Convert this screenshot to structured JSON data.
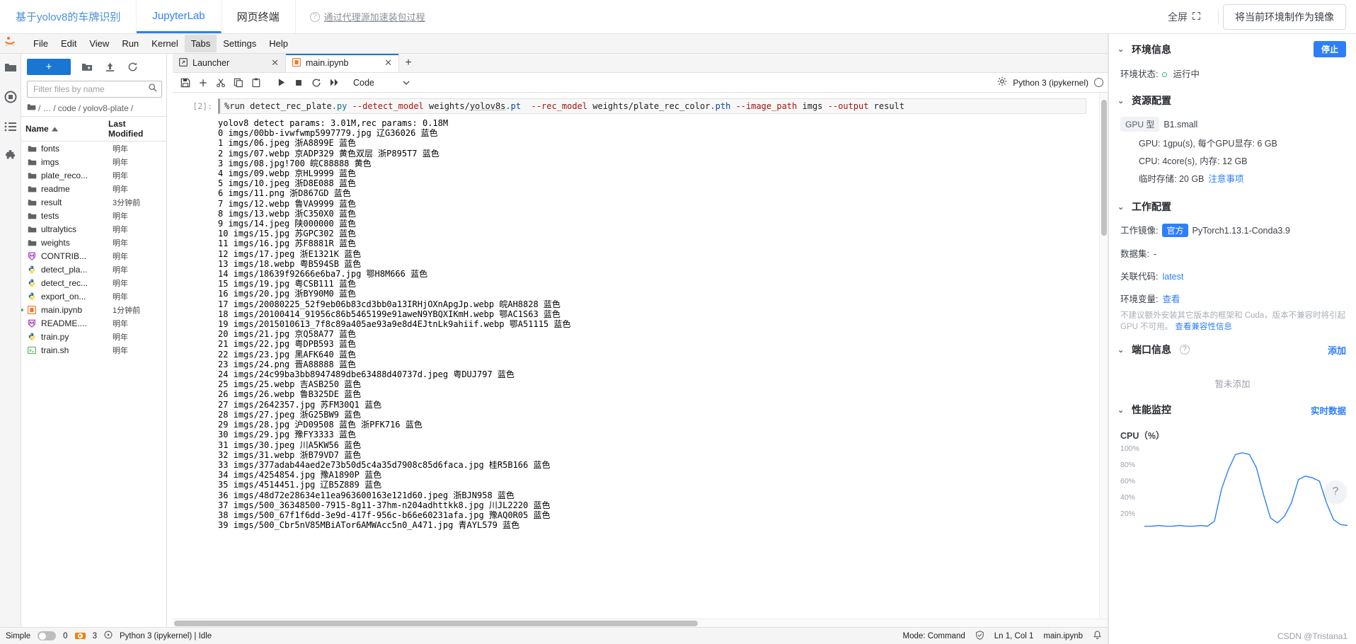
{
  "platform": {
    "tabs": [
      {
        "label": "基于yolov8的车牌识别",
        "active": false,
        "style": "link"
      },
      {
        "label": "JupyterLab",
        "active": true,
        "style": "link"
      },
      {
        "label": "网页终端",
        "active": false,
        "style": "dark"
      }
    ],
    "note": "通过代理源加速装包过程",
    "fullscreen_label": "全屏",
    "mirror_button": "将当前环境制作为镜像"
  },
  "jupyter": {
    "menus": [
      "File",
      "Edit",
      "View",
      "Run",
      "Kernel",
      "Tabs",
      "Settings",
      "Help"
    ],
    "selected_menu": "Tabs",
    "filebrowser": {
      "new_button": "+",
      "filter_placeholder": "Filter files by name",
      "filter_value": "",
      "breadcrumb": [
        "/",
        "…",
        "code",
        "yolov8-plate",
        "/"
      ],
      "columns": {
        "name": "Name",
        "modified": "Last Modified"
      },
      "rows": [
        {
          "icon": "folder-icon",
          "name": "fonts",
          "modified": "明年",
          "running": false
        },
        {
          "icon": "folder-icon",
          "name": "imgs",
          "modified": "明年",
          "running": false
        },
        {
          "icon": "folder-icon",
          "name": "plate_reco...",
          "modified": "明年",
          "running": false
        },
        {
          "icon": "folder-icon",
          "name": "readme",
          "modified": "明年",
          "running": false
        },
        {
          "icon": "folder-icon",
          "name": "result",
          "modified": "3分钟前",
          "running": false
        },
        {
          "icon": "folder-icon",
          "name": "tests",
          "modified": "明年",
          "running": false
        },
        {
          "icon": "folder-icon",
          "name": "ultralytics",
          "modified": "明年",
          "running": false
        },
        {
          "icon": "folder-icon",
          "name": "weights",
          "modified": "明年",
          "running": false
        },
        {
          "icon": "markdown-icon",
          "name": "CONTRIB...",
          "modified": "明年",
          "running": false
        },
        {
          "icon": "python-icon",
          "name": "detect_pla...",
          "modified": "明年",
          "running": false
        },
        {
          "icon": "python-icon",
          "name": "detect_rec...",
          "modified": "明年",
          "running": false
        },
        {
          "icon": "python-icon",
          "name": "export_on...",
          "modified": "明年",
          "running": false
        },
        {
          "icon": "notebook-icon",
          "name": "main.ipynb",
          "modified": "1分钟前",
          "running": true
        },
        {
          "icon": "markdown-icon",
          "name": "README....",
          "modified": "明年",
          "running": false
        },
        {
          "icon": "python-icon",
          "name": "train.py",
          "modified": "明年",
          "running": false
        },
        {
          "icon": "shell-icon",
          "name": "train.sh",
          "modified": "明年",
          "running": false
        }
      ]
    },
    "dock_tabs": [
      {
        "label": "Launcher",
        "icon": "launcher-icon",
        "active": false
      },
      {
        "label": "main.ipynb",
        "icon": "notebook-icon",
        "active": true
      }
    ],
    "dock_add": "+",
    "notebook_toolbar": {
      "cell_type": "Code",
      "kernel_name": "Python 3 (ipykernel)"
    },
    "cell": {
      "prompt": "[2]:",
      "code_parts": [
        {
          "t": "%run detect_rec_plate",
          "c": "plain"
        },
        {
          "t": ".py",
          "c": "str"
        },
        {
          "t": " ",
          "c": "plain"
        },
        {
          "t": "--detect_model",
          "c": "op"
        },
        {
          "t": " weights/",
          "c": "plain"
        },
        {
          "t": "yolov8s",
          "c": "sq"
        },
        {
          "t": ".pt",
          "c": "blue"
        },
        {
          "t": "  ",
          "c": "plain"
        },
        {
          "t": "--rec_model",
          "c": "op"
        },
        {
          "t": " weights/plate_rec_color",
          "c": "plain"
        },
        {
          "t": ".pth",
          "c": "blue"
        },
        {
          "t": " ",
          "c": "plain"
        },
        {
          "t": "--image_path",
          "c": "op"
        },
        {
          "t": " imgs ",
          "c": "plain"
        },
        {
          "t": "--output",
          "c": "op"
        },
        {
          "t": " result",
          "c": "plain"
        }
      ],
      "code_plain": "%run detect_rec_plate.py --detect_model weights/yolov8s.pt  --rec_model weights/plate_rec_color.pth --image_path imgs --output result",
      "output_lines": [
        "yolov8 detect params: 3.01M,rec params: 0.18M",
        "0 imgs/00bb-ivwfwmp5997779.jpg 辽G36026 蓝色",
        "1 imgs/06.jpeg 浙A8899E 蓝色",
        "2 imgs/07.webp 京ADP329 黄色双层 浙P895T7 蓝色",
        "3 imgs/08.jpg!700 皖C88888 黄色",
        "4 imgs/09.webp 京HL9999 蓝色",
        "5 imgs/10.jpeg 浙D8E088 蓝色",
        "6 imgs/11.png 浙D867GD 蓝色",
        "7 imgs/12.webp 鲁VA9999 蓝色",
        "8 imgs/13.webp 浙C350X0 蓝色",
        "9 imgs/14.jpeg 陕000000 蓝色",
        "10 imgs/15.jpg 苏GPC302 蓝色",
        "11 imgs/16.jpg 苏F8881R 蓝色",
        "12 imgs/17.jpeg 浙E1321K 蓝色",
        "13 imgs/18.webp 粤B594SB 蓝色",
        "14 imgs/18639f92666e6ba7.jpg 鄂H8M666 蓝色",
        "15 imgs/19.jpg 粤CSB111 蓝色",
        "16 imgs/20.jpg 浙BY90M0 蓝色",
        "17 imgs/20080225_52f9eb06b83cd3bb0a13IRHjOXnApgJp.webp 皖AH8828 蓝色",
        "18 imgs/20100414_91956c86b5465199e91aweN9YBQXIKmH.webp 鄂AC1S63 蓝色",
        "19 imgs/2015010613_7f8c89a405ae93a9e8d4EJtnLk9ahiif.webp 鄂A51115 蓝色",
        "20 imgs/21.jpg 京Q58A77 蓝色",
        "21 imgs/22.jpg 粤DPB593 蓝色",
        "22 imgs/23.jpg 黑AFK640 蓝色",
        "23 imgs/24.png 晋A88888 蓝色",
        "24 imgs/24c99ba3bb8947489dbe63488d40737d.jpeg 粤DUJ797 蓝色",
        "25 imgs/25.webp 吉ASB250 蓝色",
        "26 imgs/26.webp 鲁B325DE 蓝色",
        "27 imgs/2642357.jpg 苏FM30Q1 蓝色",
        "28 imgs/27.jpeg 浙G25BW9 蓝色",
        "29 imgs/28.jpg 沪D09508 蓝色 浙PFK716 蓝色",
        "30 imgs/29.jpg 豫FY3333 蓝色",
        "31 imgs/30.jpeg 川A5KW56 蓝色",
        "32 imgs/31.webp 浙B79VD7 蓝色",
        "33 imgs/377adab44aed2e73b50d5c4a35d7908c85d6faca.jpg 桂R5B166 蓝色",
        "34 imgs/4254854.jpg 豫A1890P 蓝色",
        "35 imgs/4514451.jpg 辽B5Z889 蓝色",
        "36 imgs/48d72e28634e11ea963600163e121d60.jpeg 浙BJN958 蓝色",
        "37 imgs/500_36348500-7915-8g11-37hm-n204adhttkk8.jpg 川JL2220 蓝色",
        "38 imgs/500_67f1f6dd-3e9d-417f-956c-b66e60231afa.jpg 豫AQ0R05 蓝色",
        "39 imgs/500_Cbr5nV85MBiATor6AMWAcc5n0_A471.jpg 青AYL579 蓝色"
      ]
    },
    "statusbar": {
      "mode_label": "Simple",
      "terminals": "0",
      "kernels": "3",
      "kernel_status": "Python 3 (ipykernel) | Idle",
      "mode": "Mode: Command",
      "position": "Ln 1, Col 1",
      "filename": "main.ipynb"
    }
  },
  "right_panel": {
    "env_info": {
      "title": "环境信息",
      "stop_button": "停止",
      "status_label": "环境状态:",
      "status_value": "运行中"
    },
    "resources": {
      "title": "资源配置",
      "gpu_type_label": "GPU 型",
      "gpu_type_value": "B1.small",
      "gpu_line": "GPU: 1gpu(s), 每个GPU显存: 6 GB",
      "cpu_line": "CPU: 4core(s), 内存: 12 GB",
      "disk_line": "临时存储: 20 GB",
      "disk_note": "注意事项"
    },
    "workspace": {
      "title": "工作配置",
      "image_label": "工作镜像:",
      "image_badge": "官方",
      "image_value": "PyTorch1.13.1-Conda3.9",
      "dataset_label": "数据集:",
      "dataset_value": "-",
      "code_label": "关联代码:",
      "code_value": "latest",
      "env_var_label": "环境变量:",
      "env_var_value": "查看",
      "warning": "不建议额外安装其它版本的框架和 Cuda，版本不兼容时将引起 GPU 不可用。",
      "warning_link": "查看兼容性信息"
    },
    "ports": {
      "title": "端口信息",
      "add_button": "添加",
      "empty": "暂未添加"
    },
    "perf": {
      "title": "性能监控",
      "realtime": "实时数据",
      "chart_title": "CPU（%）",
      "yticks": [
        "100%",
        "80%",
        "60%",
        "40%",
        "20%"
      ]
    }
  },
  "chart_data": {
    "type": "line",
    "title": "CPU（%）",
    "ylabel": "%",
    "xlabel": "",
    "ylim": [
      0,
      100
    ],
    "grid": false,
    "legend": "none",
    "x": [
      0,
      1,
      2,
      3,
      4,
      5,
      6,
      7,
      8,
      9,
      10,
      11,
      12,
      13,
      14,
      15,
      16,
      17,
      18,
      19,
      20,
      21,
      22,
      23,
      24,
      25,
      26,
      27,
      28,
      29
    ],
    "series": [
      {
        "name": "CPU",
        "color": "#2d7ff9",
        "values": [
          2,
          2,
          3,
          2,
          2,
          3,
          2,
          2,
          3,
          2,
          8,
          46,
          70,
          88,
          90,
          88,
          72,
          40,
          12,
          6,
          14,
          30,
          58,
          62,
          60,
          56,
          30,
          10,
          4,
          3
        ]
      }
    ]
  },
  "watermark": "CSDN @Tristana1"
}
